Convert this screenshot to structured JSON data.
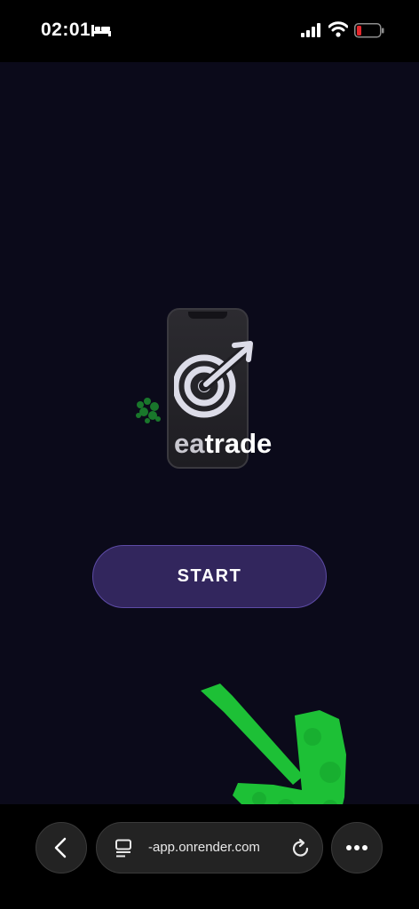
{
  "status_bar": {
    "time": "02:01",
    "icons": [
      "sleep-icon",
      "cellular-signal-icon",
      "wifi-icon",
      "battery-low-icon"
    ],
    "battery_color": "#e5272c"
  },
  "app": {
    "logo": {
      "text_prefix": "ea",
      "text_suffix": "trade",
      "icon": "target-arrow-icon"
    },
    "start_button": {
      "label": "START"
    },
    "colors": {
      "background": "#0b0a1a",
      "button": "#32265d",
      "button_border": "#5d4ba6",
      "annotation": "#1fd43a"
    }
  },
  "browser": {
    "url": "-app.onrender.com",
    "buttons": [
      "back-icon",
      "tabs-icon",
      "reload-icon",
      "more-icon"
    ]
  }
}
